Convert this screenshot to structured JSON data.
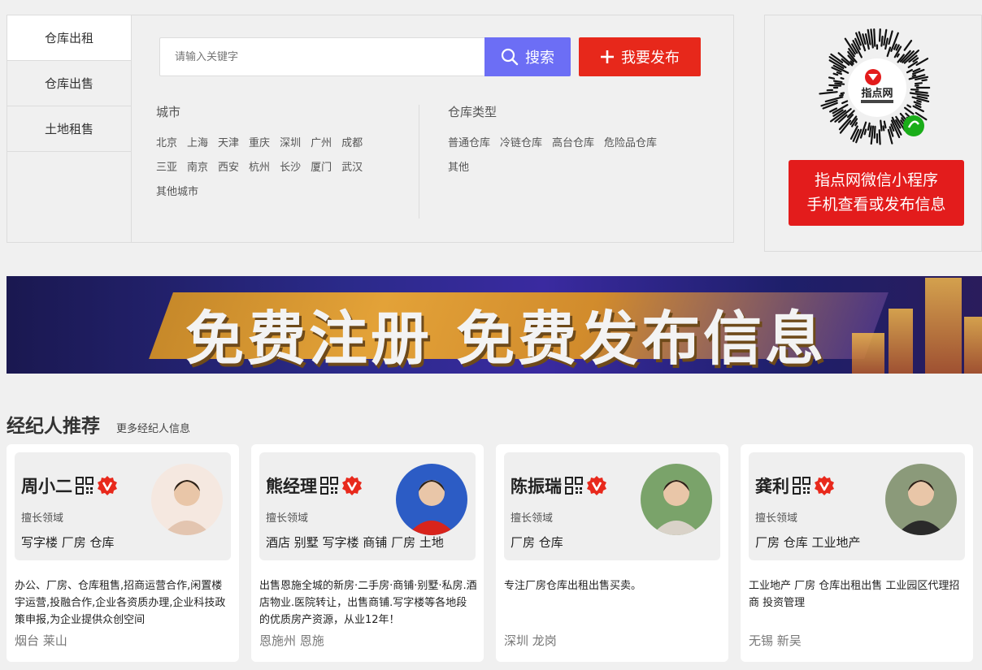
{
  "left_tabs": [
    {
      "label": "仓库出租",
      "active": true
    },
    {
      "label": "仓库出售",
      "active": false
    },
    {
      "label": "土地租售",
      "active": false
    }
  ],
  "search": {
    "placeholder": "请输入关键字",
    "button_label": "搜索",
    "publish_label": "我要发布"
  },
  "city_filter": {
    "title": "城市",
    "items": [
      "北京",
      "上海",
      "天津",
      "重庆",
      "深圳",
      "广州",
      "成都",
      "三亚",
      "南京",
      "西安",
      "杭州",
      "长沙",
      "厦门",
      "武汉",
      "其他城市"
    ]
  },
  "type_filter": {
    "title": "仓库类型",
    "items": [
      "普通仓库",
      "冷链仓库",
      "高台仓库",
      "危险品仓库",
      "其他"
    ]
  },
  "qr_panel": {
    "logo_text": "指点网",
    "button_line1": "指点网微信小程序",
    "button_line2": "手机查看或发布信息"
  },
  "banner": {
    "text": "免费注册  免费发布信息"
  },
  "agents_section": {
    "title": "经纪人推荐",
    "more_label": "更多经纪人信息",
    "skill_label": "擅长领域",
    "agents": [
      {
        "name": "周小二",
        "skills": "写字楼 厂房 仓库",
        "desc": "办公、厂房、仓库租售,招商运营合作,闲置楼宇运营,投融合作,企业各资质办理,企业科技政策申报,为企业提供众创空间",
        "location": "烟台 莱山"
      },
      {
        "name": "熊经理",
        "skills": "酒店 别墅 写字楼 商铺 厂房 土地",
        "desc": "出售恩施全城的新房·二手房·商铺·别墅·私房.酒店物业.医院转让，出售商铺.写字楼等各地段的优质房产资源，从业12年！",
        "location": "恩施州 恩施"
      },
      {
        "name": "陈振瑞",
        "skills": "厂房 仓库",
        "desc": "专注厂房仓库出租出售买卖。",
        "location": "深圳 龙岗"
      },
      {
        "name": "龚利",
        "skills": "厂房 仓库 工业地产",
        "desc": "工业地产 厂房 仓库出租出售 工业园区代理招商 投资管理",
        "location": "无锡 新吴"
      }
    ]
  },
  "colors": {
    "search_button": "#6c6ef5",
    "publish_button": "#e7281b",
    "qr_button": "#e31c1c",
    "badge_red": "#e8291c"
  }
}
